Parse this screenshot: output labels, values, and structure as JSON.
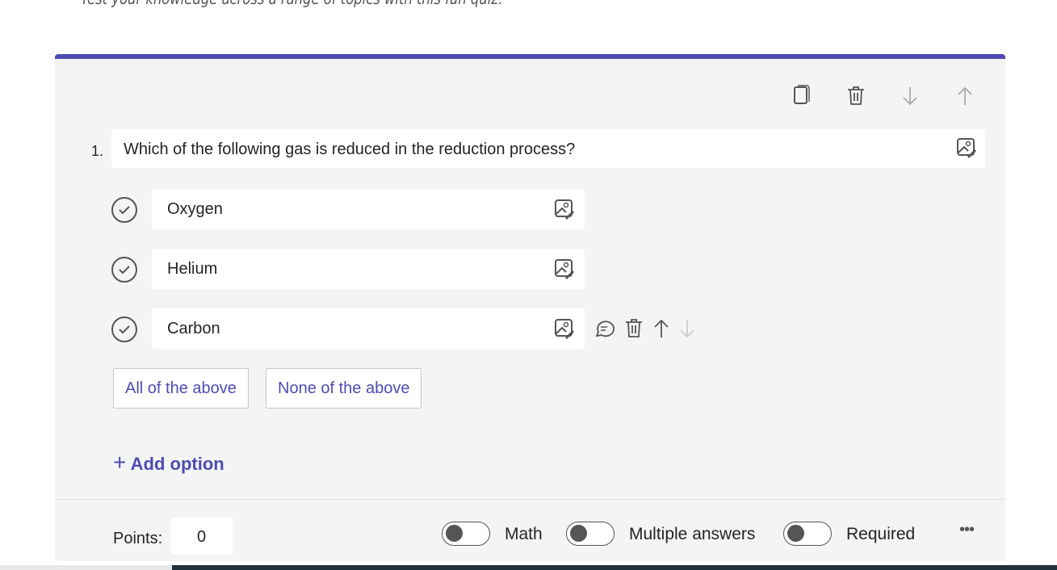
{
  "form": {
    "subtitle": "Test your knowledge across a range of topics with this fun quiz!"
  },
  "question": {
    "number": "1.",
    "text": "Which of the following gas is reduced in the reduction process?",
    "toolbar": [
      "copy-icon",
      "delete-icon",
      "move-down-icon",
      "move-up-icon"
    ],
    "options": [
      {
        "label": "Oxygen"
      },
      {
        "label": "Helium"
      },
      {
        "label": "Carbon"
      }
    ],
    "quick_options": [
      "All of the above",
      "None of the above"
    ],
    "add_option": "Add option",
    "points_label": "Points:",
    "points_value": "0",
    "toggles": [
      {
        "label": "Math",
        "on": false
      },
      {
        "label": "Multiple answers",
        "on": false
      },
      {
        "label": "Required",
        "on": false
      }
    ],
    "accent": "#4f4bb3"
  }
}
